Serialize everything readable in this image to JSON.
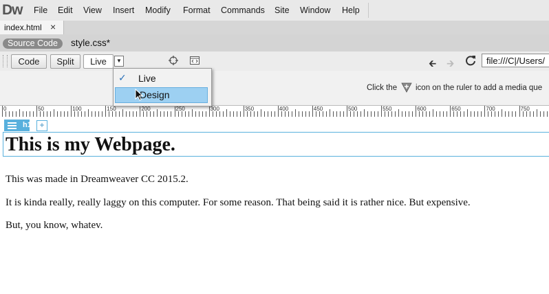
{
  "app": {
    "logo": "Dw"
  },
  "menu": [
    "File",
    "Edit",
    "View",
    "Insert",
    "Modify",
    "Format",
    "Commands",
    "Site",
    "Window",
    "Help"
  ],
  "tabs": {
    "active": "index.html",
    "close": "×"
  },
  "related": {
    "source_code": "Source Code",
    "style_css": "style.css*"
  },
  "toolbar": {
    "code": "Code",
    "split": "Split",
    "live": "Live",
    "live_arrow": "▼",
    "back": "🡰",
    "forward": "🡲",
    "address": "file:///C|/Users/"
  },
  "media_query": {
    "text_before": "Click the",
    "text_after": "icon on the ruler to add a media que"
  },
  "ruler": {
    "labels": [
      "0",
      "50",
      "100",
      "150",
      "200",
      "250",
      "300",
      "350",
      "400",
      "450",
      "500",
      "550",
      "600",
      "650",
      "700",
      "750"
    ]
  },
  "element": {
    "tag": "h1",
    "add": "+"
  },
  "page": {
    "heading": "This is my Webpage.",
    "p1": "This was made in Dreamweaver CC 2015.2.",
    "p2": "It is kinda really, really laggy on this computer. For some reason. That being said it is rather nice. But expensive.",
    "p3": "But, you know, whatev."
  },
  "dropdown": {
    "check": "✓",
    "live": "Live",
    "design": "Design"
  },
  "colors": {
    "highlight": "#9dd0f2",
    "element_badge": "#58b0dd"
  }
}
